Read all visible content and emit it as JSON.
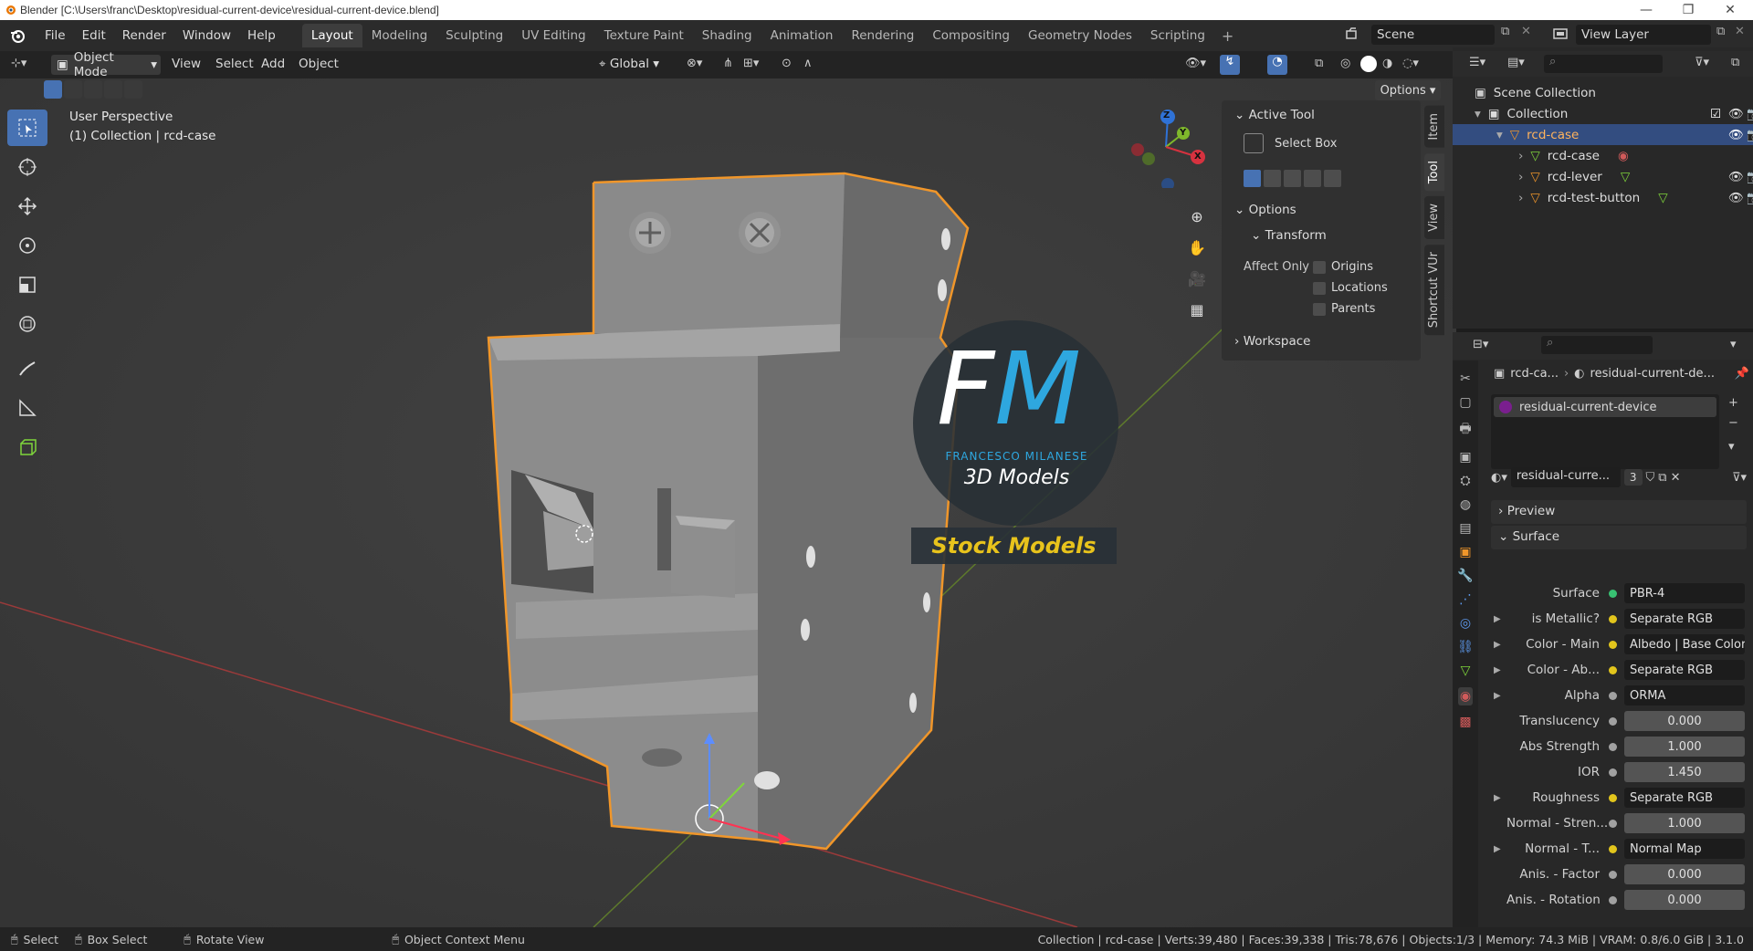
{
  "window": {
    "title": "Blender [C:\\Users\\franc\\Desktop\\residual-current-device\\residual-current-device.blend]",
    "minimize": "—",
    "maximize": "❐",
    "close": "✕"
  },
  "menu": [
    "File",
    "Edit",
    "Render",
    "Window",
    "Help"
  ],
  "workspaces": [
    "Layout",
    "Modeling",
    "Sculpting",
    "UV Editing",
    "Texture Paint",
    "Shading",
    "Animation",
    "Rendering",
    "Compositing",
    "Geometry Nodes",
    "Scripting"
  ],
  "active_workspace": "Layout",
  "scene": {
    "name": "Scene",
    "view_layer": "View Layer"
  },
  "viewport_header": {
    "mode": "Object Mode",
    "menus": [
      "View",
      "Select",
      "Add",
      "Object"
    ],
    "transform_orientation": "Global",
    "options_label": "Options"
  },
  "viewport": {
    "perspective": "User Perspective",
    "collection_info": "(1) Collection | rcd-case",
    "logo": {
      "initial_f": "F",
      "initial_m": "M",
      "name": "FRANCESCO MILANESE",
      "tagline": "3D Models",
      "banner": "Stock Models"
    },
    "gizmo_axes": [
      "Z",
      "Y",
      "X"
    ]
  },
  "npanel": {
    "tabs": [
      "Item",
      "Tool",
      "View",
      "Shortcut VUr"
    ],
    "active_tool_header": "Active Tool",
    "active_tool_name": "Select Box",
    "options_header": "Options",
    "transform_header": "Transform",
    "affect_only_label": "Affect Only",
    "affect_only_options": [
      "Origins",
      "Locations",
      "Parents"
    ],
    "workspace_header": "Workspace"
  },
  "outliner": {
    "scene_collection": "Scene Collection",
    "collection": "Collection",
    "objects": [
      {
        "name": "rcd-case",
        "selected": true
      },
      {
        "name": "rcd-case",
        "child": true
      },
      {
        "name": "rcd-lever",
        "child": true
      },
      {
        "name": "rcd-test-button",
        "child": true
      }
    ]
  },
  "properties": {
    "breadcrumb_object": "rcd-ca...",
    "breadcrumb_material": "residual-current-de...",
    "material_slot": "residual-current-device",
    "material_selector": "residual-curre...",
    "material_users": "3",
    "preview_header": "Preview",
    "surface_header": "Surface",
    "rows": [
      {
        "label": "Surface",
        "value": "PBR-4",
        "dot": "#38c172",
        "type": "link",
        "expand": false
      },
      {
        "label": "is Metallic?",
        "value": "Separate RGB",
        "dot": "#e2c51c",
        "type": "link",
        "expand": true
      },
      {
        "label": "Color - Main",
        "value": "Albedo | Base Color",
        "dot": "#e2c51c",
        "type": "link",
        "expand": true
      },
      {
        "label": "Color - Ab...",
        "value": "Separate RGB",
        "dot": "#e2c51c",
        "type": "link",
        "expand": true
      },
      {
        "label": "Alpha",
        "value": "ORMA",
        "dot": "#a1a1a1",
        "type": "link",
        "expand": true
      },
      {
        "label": "Translucency",
        "value": "0.000",
        "dot": "#a1a1a1",
        "type": "num",
        "expand": false
      },
      {
        "label": "Abs Strength",
        "value": "1.000",
        "dot": "#a1a1a1",
        "type": "num",
        "expand": false
      },
      {
        "label": "IOR",
        "value": "1.450",
        "dot": "#a1a1a1",
        "type": "num",
        "expand": false
      },
      {
        "label": "Roughness",
        "value": "Separate RGB",
        "dot": "#e2c51c",
        "type": "link",
        "expand": true
      },
      {
        "label": "Normal - Stren...",
        "value": "1.000",
        "dot": "#a1a1a1",
        "type": "num",
        "expand": false
      },
      {
        "label": "Normal - T...",
        "value": "Normal Map",
        "dot": "#e2c51c",
        "type": "link",
        "expand": true
      },
      {
        "label": "Anis. - Factor",
        "value": "0.000",
        "dot": "#a1a1a1",
        "type": "num",
        "expand": false
      },
      {
        "label": "Anis. - Rotation",
        "value": "0.000",
        "dot": "#a1a1a1",
        "type": "num",
        "expand": false
      }
    ]
  },
  "statusbar": {
    "select": "Select",
    "box_select": "Box Select",
    "rotate_view": "Rotate View",
    "context_menu": "Object Context Menu",
    "stats": "Collection | rcd-case | Verts:39,480 | Faces:39,338 | Tris:78,676 | Objects:1/3 | Memory: 74.3 MiB | VRAM: 0.8/6.0 GiB | 3.1.0"
  },
  "colors": {
    "accent": "#4772b3",
    "selection_outline": "#f0962a",
    "logo_blue": "#2ea7df",
    "banner_yellow": "#e8c31c"
  }
}
